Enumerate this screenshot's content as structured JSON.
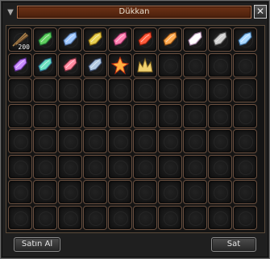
{
  "window": {
    "title": "Dükkan",
    "close_icon": "close-icon",
    "title_icon": "shield-icon"
  },
  "grid": {
    "rows": 8,
    "columns": 10
  },
  "items": [
    {
      "name": "arrow-bundle",
      "quantity": "200",
      "colors": [
        "#b08850",
        "#6a4a2a"
      ]
    },
    {
      "name": "green-gem",
      "quantity": "",
      "colors": [
        "#5fcf5f",
        "#1f6f2f"
      ]
    },
    {
      "name": "blue-silver-gem",
      "quantity": "",
      "colors": [
        "#9fc8ff",
        "#4a6a9a"
      ]
    },
    {
      "name": "yellow-gem",
      "quantity": "",
      "colors": [
        "#e8d050",
        "#8a6a10"
      ]
    },
    {
      "name": "pink-gem",
      "quantity": "",
      "colors": [
        "#ff7fb0",
        "#8a2a5a"
      ]
    },
    {
      "name": "red-gem",
      "quantity": "",
      "colors": [
        "#ff5a3a",
        "#8a1a0a"
      ]
    },
    {
      "name": "orange-gem",
      "quantity": "",
      "colors": [
        "#ffaa50",
        "#8a4a10"
      ]
    },
    {
      "name": "white-crystal",
      "quantity": "",
      "colors": [
        "#ffffff",
        "#aa88aa"
      ]
    },
    {
      "name": "grey-crystal",
      "quantity": "",
      "colors": [
        "#d0d0d0",
        "#5a5a5a"
      ]
    },
    {
      "name": "blue-crystal",
      "quantity": "",
      "colors": [
        "#aad8ff",
        "#3a6a9a"
      ]
    },
    {
      "name": "purple-gem",
      "quantity": "",
      "colors": [
        "#c88aff",
        "#5a2a8a"
      ]
    },
    {
      "name": "teal-gem",
      "quantity": "",
      "colors": [
        "#6adfc0",
        "#2a6a8a"
      ]
    },
    {
      "name": "rose-gem",
      "quantity": "",
      "colors": [
        "#ff8aa0",
        "#7a2a3a"
      ]
    },
    {
      "name": "steel-gem",
      "quantity": "",
      "colors": [
        "#b0c8e0",
        "#3a4a6a"
      ]
    },
    {
      "name": "flame-star",
      "quantity": "",
      "colors": [
        "#ffb040",
        "#c03010"
      ]
    },
    {
      "name": "golden-crown",
      "quantity": "",
      "colors": [
        "#f0d070",
        "#8a6a20"
      ]
    }
  ],
  "buttons": {
    "buy_label": "Satın Al",
    "sell_label": "Sat"
  }
}
